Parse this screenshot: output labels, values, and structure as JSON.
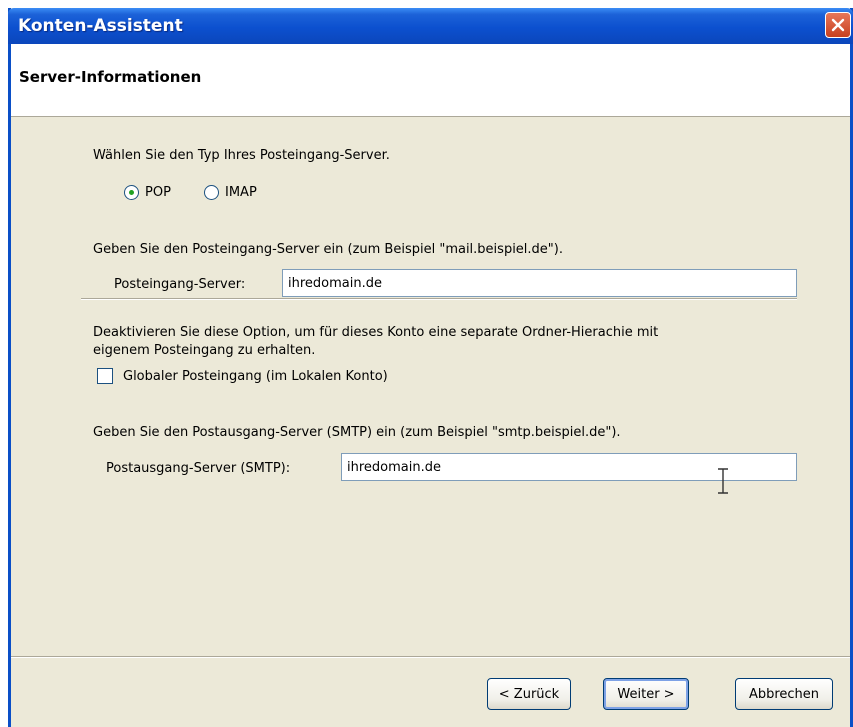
{
  "window": {
    "title": "Konten-Assistent",
    "header_title": "Server-Informationen"
  },
  "incoming_type": {
    "prompt": "Wählen Sie den Typ Ihres Posteingang-Server.",
    "options": [
      {
        "label": "POP",
        "selected": true
      },
      {
        "label": "IMAP",
        "selected": false
      }
    ]
  },
  "incoming_server": {
    "prompt": "Geben Sie den Posteingang-Server ein (zum Beispiel \"mail.beispiel.de\").",
    "label": "Posteingang-Server:",
    "value": "ihredomain.de"
  },
  "global_inbox": {
    "description_line1": "Deaktivieren Sie diese Option, um für dieses Konto eine separate Ordner-Hierachie mit",
    "description_line2": "eigenem Posteingang zu erhalten.",
    "checkbox_label": "Globaler Posteingang (im Lokalen Konto)",
    "checked": false
  },
  "outgoing_server": {
    "prompt": "Geben Sie den Postausgang-Server (SMTP) ein (zum Beispiel \"smtp.beispiel.de\").",
    "label": "Postausgang-Server (SMTP):",
    "value": "ihredomain.de"
  },
  "buttons": {
    "back": "< Zurück",
    "next": "Weiter >",
    "cancel": "Abbrechen"
  },
  "colors": {
    "titlebar": "#0c50cf",
    "dialog_bg": "#ece9d8",
    "radio_dot": "#21a121",
    "close_button": "#c7401f"
  },
  "icons": {
    "close": "close-icon",
    "cursor": "text-cursor-icon"
  }
}
